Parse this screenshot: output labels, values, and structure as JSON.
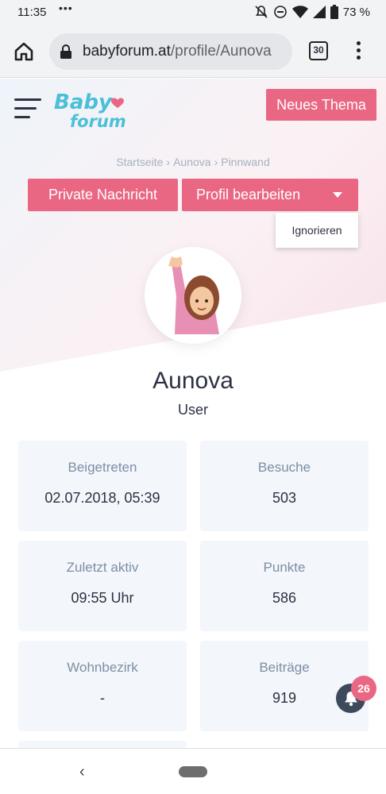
{
  "statusbar": {
    "time": "11:35",
    "dots": "•••",
    "battery": "73 %",
    "icons": [
      "mute-icon",
      "dnd-icon",
      "wifi-icon",
      "signal-icon",
      "battery-icon"
    ]
  },
  "browser": {
    "url_domain": "babyforum.at",
    "url_path": "/profile/Aunova",
    "tab_count": "30"
  },
  "header": {
    "logo_text_top": "Baby",
    "logo_text_bottom": "forum",
    "new_topic_label": "Neues Thema"
  },
  "breadcrumb": {
    "items": [
      "Startseite",
      "Aunova",
      "Pinnwand"
    ],
    "separator": "›"
  },
  "actions": {
    "private_message_label": "Private Nachricht",
    "edit_profile_label": "Profil bearbeiten",
    "dropdown_items": [
      "Ignorieren"
    ]
  },
  "profile": {
    "name": "Aunova",
    "role": "User",
    "stats": [
      {
        "label": "Beigetreten",
        "value": "02.07.2018, 05:39"
      },
      {
        "label": "Besuche",
        "value": "503"
      },
      {
        "label": "Zuletzt aktiv",
        "value": "09:55 Uhr"
      },
      {
        "label": "Punkte",
        "value": "586"
      },
      {
        "label": "Wohnbezirk",
        "value": "-"
      },
      {
        "label": "Beiträge",
        "value": "919"
      }
    ]
  },
  "notifications": {
    "count": "26"
  },
  "colors": {
    "accent": "#ea6783",
    "logo_blue": "#4bbfd8",
    "text_dark": "#2d3142",
    "card_bg": "#f3f6fa"
  }
}
